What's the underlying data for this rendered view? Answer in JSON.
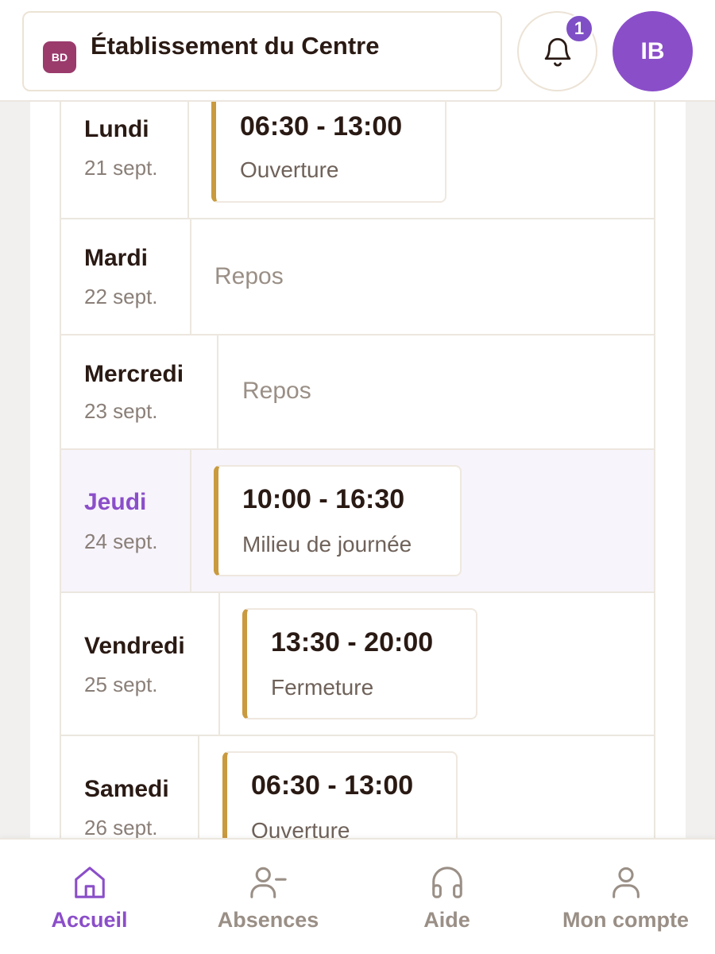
{
  "header": {
    "org_initials": "BD",
    "org_name": "Établissement du Centre",
    "notification_count": "1",
    "user_initials": "IB"
  },
  "schedule": [
    {
      "day": "Lundi",
      "date": "21 sept.",
      "status": "shift",
      "time": "06:30 - 13:00",
      "label": "Ouverture"
    },
    {
      "day": "Mardi",
      "date": "22 sept.",
      "status": "off",
      "label": "Repos"
    },
    {
      "day": "Mercredi",
      "date": "23 sept.",
      "status": "off",
      "label": "Repos"
    },
    {
      "day": "Jeudi",
      "date": "24 sept.",
      "status": "shift",
      "today": true,
      "time": "10:00 - 16:30",
      "label": "Milieu de journée"
    },
    {
      "day": "Vendredi",
      "date": "25 sept.",
      "status": "shift",
      "time": "13:30 - 20:00",
      "label": "Fermeture"
    },
    {
      "day": "Samedi",
      "date": "26 sept.",
      "status": "shift",
      "time": "06:30 - 13:00",
      "label": "Ouverture"
    }
  ],
  "nav": {
    "items": [
      {
        "label": "Accueil",
        "icon": "home-icon",
        "active": true
      },
      {
        "label": "Absences",
        "icon": "user-minus-icon",
        "active": false
      },
      {
        "label": "Aide",
        "icon": "headphones-icon",
        "active": false
      },
      {
        "label": "Mon compte",
        "icon": "user-icon",
        "active": false
      }
    ]
  },
  "colors": {
    "accent": "#8b4ec9",
    "shift_bar": "#c99a3e",
    "org_badge": "#9a3b6c",
    "text_dark": "#2a1a14",
    "text_muted": "#9a8f86"
  }
}
